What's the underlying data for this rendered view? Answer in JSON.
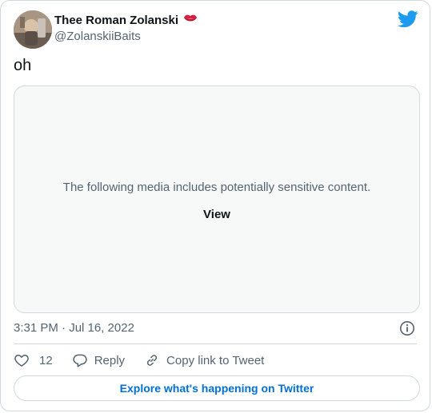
{
  "author": {
    "display_name": "Thee Roman Zolanski",
    "emoji": "💋",
    "handle": "@ZolanskiiBaits",
    "avatar_icon": "profile-photo"
  },
  "tweet": {
    "text": "oh",
    "timestamp": "3:31 PM · Jul 16, 2022"
  },
  "media": {
    "warning_text": "The following media includes potentially sensitive content.",
    "view_label": "View"
  },
  "actions": {
    "like_count": "12",
    "reply_label": "Reply",
    "copy_link_label": "Copy link to Tweet"
  },
  "footer": {
    "explore_label": "Explore what's happening on Twitter"
  },
  "colors": {
    "brand": "#1d9bf0",
    "link": "#006fd6",
    "text_primary": "#0f1419",
    "text_secondary": "#536471",
    "border": "#cfd9de",
    "media_bg": "#f7f9f9"
  }
}
